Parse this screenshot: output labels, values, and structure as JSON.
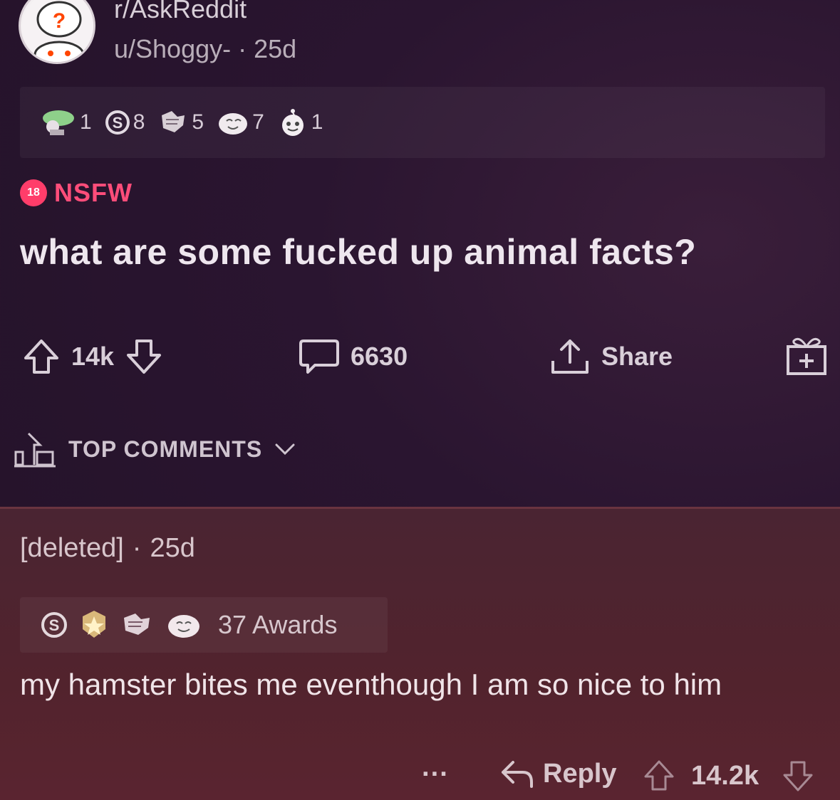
{
  "post": {
    "subreddit": "r/AskReddit",
    "author": "u/Shoggy-",
    "separator": "·",
    "age": "25d",
    "awards": [
      {
        "icon": "wholesome-award-icon",
        "count": "1"
      },
      {
        "icon": "silver-award-icon",
        "count": "8"
      },
      {
        "icon": "helpful-award-icon",
        "count": "5"
      },
      {
        "icon": "laughing-award-icon",
        "count": "7"
      },
      {
        "icon": "snoo-award-icon",
        "count": "1"
      }
    ],
    "nsfw_badge": "18",
    "nsfw_label": "NSFW",
    "title": "what are some fucked up animal facts?",
    "upvotes": "14k",
    "comments": "6630",
    "share_label": "Share"
  },
  "sort": {
    "label": "TOP COMMENTS"
  },
  "comment": {
    "author": "[deleted]",
    "separator": "·",
    "age": "25d",
    "award_icons": [
      "silver-award-icon",
      "gold-award-icon",
      "helpful-award-icon",
      "laughing-award-icon"
    ],
    "awards_label": "37 Awards",
    "body": "my hamster bites me eventhough I am so nice to him",
    "more_label": "···",
    "reply_label": "Reply",
    "score": "14.2k"
  },
  "colors": {
    "nsfw": "#ff4d7a",
    "background": "#2a1530",
    "comment_background": "#52232d"
  }
}
